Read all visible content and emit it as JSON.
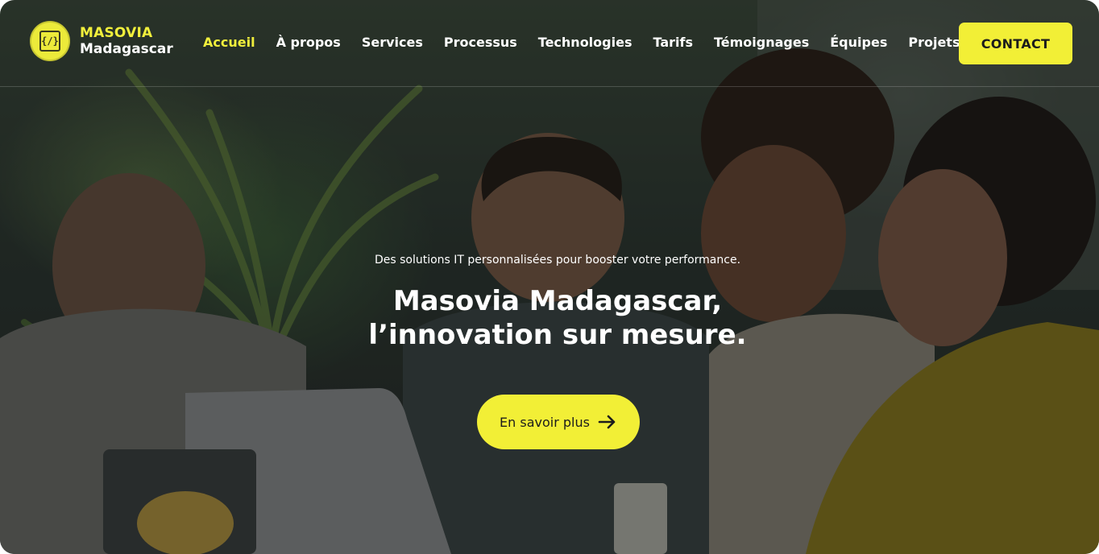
{
  "brand": {
    "name_top": "MASOVIA",
    "name_bottom": "Madagascar",
    "logo_glyph": "{/}",
    "accent_color": "#f2ef36"
  },
  "nav": {
    "items": [
      {
        "label": "Accueil",
        "active": true
      },
      {
        "label": "À propos"
      },
      {
        "label": "Services"
      },
      {
        "label": "Processus"
      },
      {
        "label": "Technologies"
      },
      {
        "label": "Tarifs"
      },
      {
        "label": "Témoignages"
      },
      {
        "label": "Équipes"
      },
      {
        "label": "Projets"
      }
    ]
  },
  "header": {
    "contact_label": "CONTACT"
  },
  "hero": {
    "tagline": "Des solutions IT personnalisées pour booster votre performance.",
    "title_line1": "Masovia Madagascar,",
    "title_line2": "l’innovation sur mesure.",
    "cta_label": "En savoir plus",
    "cta_icon": "arrow-right-icon"
  }
}
